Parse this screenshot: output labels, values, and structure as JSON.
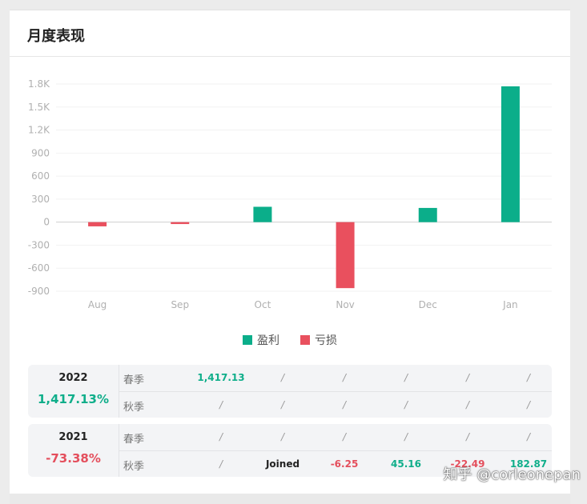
{
  "card_title": "月度表现",
  "colors": {
    "profit": "#0bae8a",
    "loss": "#e9505e",
    "positive_text": "#0fae8a",
    "negative_text": "#e44f5d"
  },
  "legend": {
    "profit_label": "盈利",
    "loss_label": "亏损"
  },
  "chart_data": {
    "type": "bar",
    "categories": [
      "Aug",
      "Sep",
      "Oct",
      "Nov",
      "Dec",
      "Jan"
    ],
    "series": [
      {
        "values": [
          -55,
          -25,
          200,
          -860,
          185,
          1770
        ]
      }
    ],
    "yticks": [
      "1.8K",
      "1.5K",
      "1.2K",
      "900",
      "600",
      "300",
      "0",
      "-300",
      "-600",
      "-900"
    ],
    "ytick_values": [
      1800,
      1500,
      1200,
      900,
      600,
      300,
      0,
      -300,
      -600,
      -900
    ],
    "ylim": [
      -900,
      1800
    ],
    "grid": true
  },
  "years": [
    {
      "year": "2022",
      "total": "1,417.13%",
      "rows": [
        {
          "season": "春季",
          "cells": [
            "1,417.13",
            "/",
            "/",
            "/",
            "/",
            "/"
          ]
        },
        {
          "season": "秋季",
          "cells": [
            "/",
            "/",
            "/",
            "/",
            "/",
            "/"
          ]
        }
      ]
    },
    {
      "year": "2021",
      "total": "-73.38%",
      "rows": [
        {
          "season": "春季",
          "cells": [
            "/",
            "/",
            "/",
            "/",
            "/",
            "/"
          ]
        },
        {
          "season": "秋季",
          "cells": [
            "/",
            "Joined",
            "-6.25",
            "45.16",
            "-22.49",
            "182.87"
          ]
        }
      ]
    }
  ],
  "watermark": "知乎 @corleonepan"
}
